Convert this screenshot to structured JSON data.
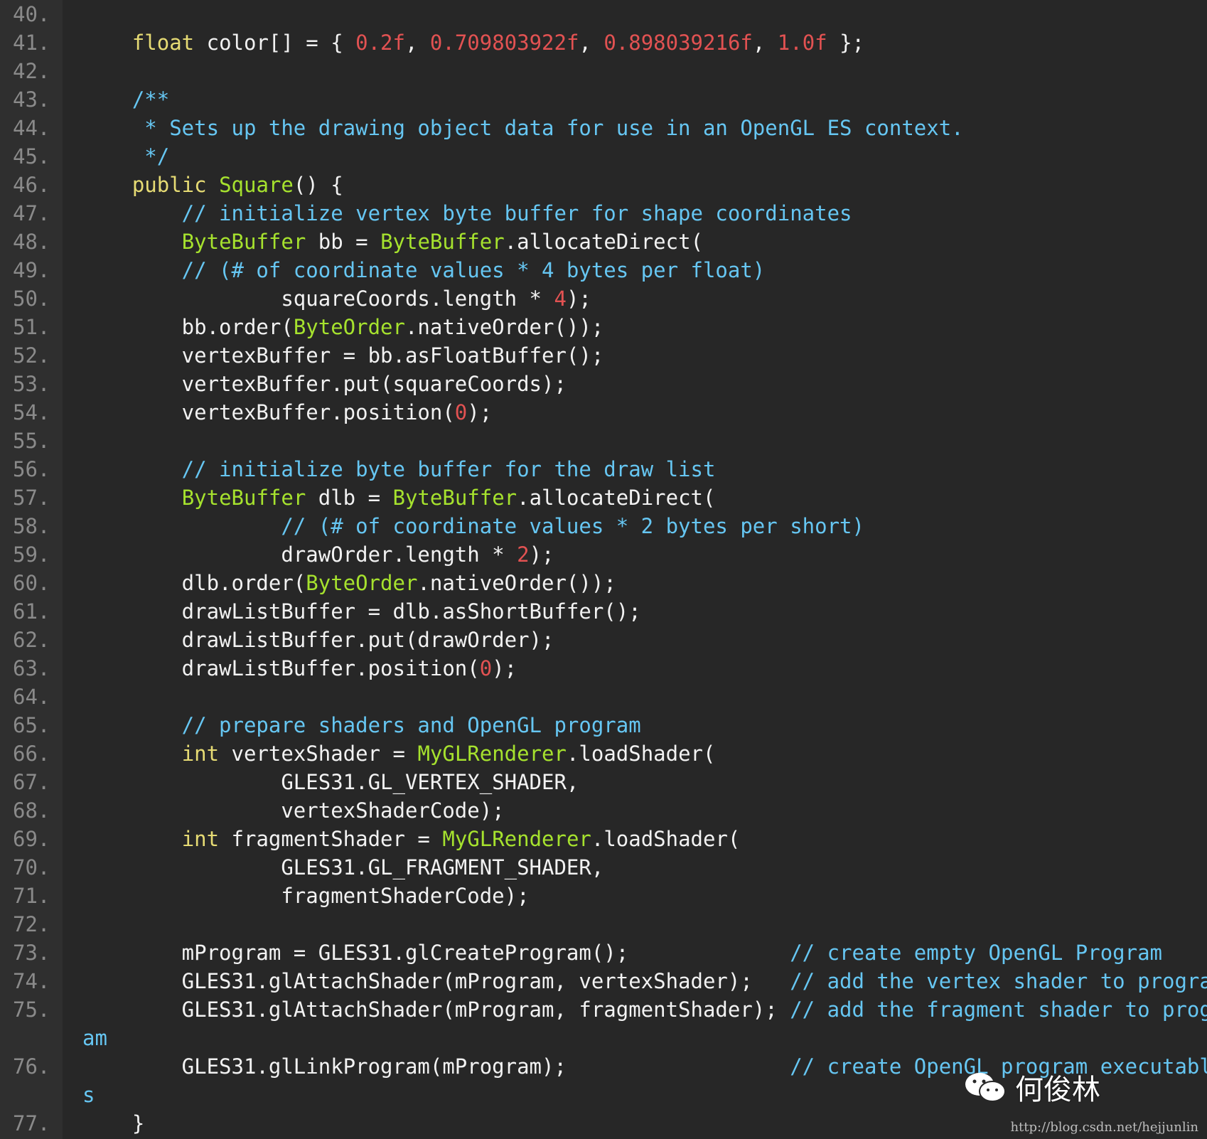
{
  "editor": {
    "colors": {
      "background": "#272727",
      "gutter": "#2f2f2f",
      "keyword": "#e6db74",
      "type": "#a6e22e",
      "number": "#e25252",
      "comment": "#66c6f2",
      "plain": "#f2f2f2"
    },
    "lines": [
      {
        "n": "40.",
        "tokens": []
      },
      {
        "n": "41.",
        "tokens": [
          {
            "t": "    ",
            "c": "pl"
          },
          {
            "t": "float",
            "c": "kw"
          },
          {
            "t": " color[] = { ",
            "c": "pl"
          },
          {
            "t": "0.2f",
            "c": "num"
          },
          {
            "t": ", ",
            "c": "pl"
          },
          {
            "t": "0.709803922f",
            "c": "num"
          },
          {
            "t": ", ",
            "c": "pl"
          },
          {
            "t": "0.898039216f",
            "c": "num"
          },
          {
            "t": ", ",
            "c": "pl"
          },
          {
            "t": "1.0f",
            "c": "num"
          },
          {
            "t": " };",
            "c": "pl"
          }
        ]
      },
      {
        "n": "42.",
        "tokens": []
      },
      {
        "n": "43.",
        "tokens": [
          {
            "t": "    /**",
            "c": "cm"
          }
        ]
      },
      {
        "n": "44.",
        "tokens": [
          {
            "t": "     * Sets up the drawing object data for use in an OpenGL ES context.",
            "c": "cm"
          }
        ]
      },
      {
        "n": "45.",
        "tokens": [
          {
            "t": "     */",
            "c": "cm"
          }
        ]
      },
      {
        "n": "46.",
        "tokens": [
          {
            "t": "    ",
            "c": "pl"
          },
          {
            "t": "public",
            "c": "kw"
          },
          {
            "t": " ",
            "c": "pl"
          },
          {
            "t": "Square",
            "c": "ty"
          },
          {
            "t": "() {",
            "c": "pl"
          }
        ]
      },
      {
        "n": "47.",
        "tokens": [
          {
            "t": "        // initialize vertex byte buffer for shape coordinates",
            "c": "cm"
          }
        ]
      },
      {
        "n": "48.",
        "tokens": [
          {
            "t": "        ",
            "c": "pl"
          },
          {
            "t": "ByteBuffer",
            "c": "ty"
          },
          {
            "t": " bb = ",
            "c": "pl"
          },
          {
            "t": "ByteBuffer",
            "c": "ty"
          },
          {
            "t": ".allocateDirect(",
            "c": "pl"
          }
        ]
      },
      {
        "n": "49.",
        "tokens": [
          {
            "t": "        // (# of coordinate values * 4 bytes per float)",
            "c": "cm"
          }
        ]
      },
      {
        "n": "50.",
        "tokens": [
          {
            "t": "                squareCoords.length * ",
            "c": "pl"
          },
          {
            "t": "4",
            "c": "num"
          },
          {
            "t": ");",
            "c": "pl"
          }
        ]
      },
      {
        "n": "51.",
        "tokens": [
          {
            "t": "        bb.order(",
            "c": "pl"
          },
          {
            "t": "ByteOrder",
            "c": "ty"
          },
          {
            "t": ".nativeOrder());",
            "c": "pl"
          }
        ]
      },
      {
        "n": "52.",
        "tokens": [
          {
            "t": "        vertexBuffer = bb.asFloatBuffer();",
            "c": "pl"
          }
        ]
      },
      {
        "n": "53.",
        "tokens": [
          {
            "t": "        vertexBuffer.put(squareCoords);",
            "c": "pl"
          }
        ]
      },
      {
        "n": "54.",
        "tokens": [
          {
            "t": "        vertexBuffer.position(",
            "c": "pl"
          },
          {
            "t": "0",
            "c": "num"
          },
          {
            "t": ");",
            "c": "pl"
          }
        ]
      },
      {
        "n": "55.",
        "tokens": []
      },
      {
        "n": "56.",
        "tokens": [
          {
            "t": "        // initialize byte buffer for the draw list",
            "c": "cm"
          }
        ]
      },
      {
        "n": "57.",
        "tokens": [
          {
            "t": "        ",
            "c": "pl"
          },
          {
            "t": "ByteBuffer",
            "c": "ty"
          },
          {
            "t": " dlb = ",
            "c": "pl"
          },
          {
            "t": "ByteBuffer",
            "c": "ty"
          },
          {
            "t": ".allocateDirect(",
            "c": "pl"
          }
        ]
      },
      {
        "n": "58.",
        "tokens": [
          {
            "t": "                // (# of coordinate values * 2 bytes per short)",
            "c": "cm"
          }
        ]
      },
      {
        "n": "59.",
        "tokens": [
          {
            "t": "                drawOrder.length * ",
            "c": "pl"
          },
          {
            "t": "2",
            "c": "num"
          },
          {
            "t": ");",
            "c": "pl"
          }
        ]
      },
      {
        "n": "60.",
        "tokens": [
          {
            "t": "        dlb.order(",
            "c": "pl"
          },
          {
            "t": "ByteOrder",
            "c": "ty"
          },
          {
            "t": ".nativeOrder());",
            "c": "pl"
          }
        ]
      },
      {
        "n": "61.",
        "tokens": [
          {
            "t": "        drawListBuffer = dlb.asShortBuffer();",
            "c": "pl"
          }
        ]
      },
      {
        "n": "62.",
        "tokens": [
          {
            "t": "        drawListBuffer.put(drawOrder);",
            "c": "pl"
          }
        ]
      },
      {
        "n": "63.",
        "tokens": [
          {
            "t": "        drawListBuffer.position(",
            "c": "pl"
          },
          {
            "t": "0",
            "c": "num"
          },
          {
            "t": ");",
            "c": "pl"
          }
        ]
      },
      {
        "n": "64.",
        "tokens": []
      },
      {
        "n": "65.",
        "tokens": [
          {
            "t": "        // prepare shaders and OpenGL program",
            "c": "cm"
          }
        ]
      },
      {
        "n": "66.",
        "tokens": [
          {
            "t": "        ",
            "c": "pl"
          },
          {
            "t": "int",
            "c": "kw"
          },
          {
            "t": " vertexShader = ",
            "c": "pl"
          },
          {
            "t": "MyGLRenderer",
            "c": "ty"
          },
          {
            "t": ".loadShader(",
            "c": "pl"
          }
        ]
      },
      {
        "n": "67.",
        "tokens": [
          {
            "t": "                GLES31.GL_VERTEX_SHADER,",
            "c": "pl"
          }
        ]
      },
      {
        "n": "68.",
        "tokens": [
          {
            "t": "                vertexShaderCode);",
            "c": "pl"
          }
        ]
      },
      {
        "n": "69.",
        "tokens": [
          {
            "t": "        ",
            "c": "pl"
          },
          {
            "t": "int",
            "c": "kw"
          },
          {
            "t": " fragmentShader = ",
            "c": "pl"
          },
          {
            "t": "MyGLRenderer",
            "c": "ty"
          },
          {
            "t": ".loadShader(",
            "c": "pl"
          }
        ]
      },
      {
        "n": "70.",
        "tokens": [
          {
            "t": "                GLES31.GL_FRAGMENT_SHADER,",
            "c": "pl"
          }
        ]
      },
      {
        "n": "71.",
        "tokens": [
          {
            "t": "                fragmentShaderCode);",
            "c": "pl"
          }
        ]
      },
      {
        "n": "72.",
        "tokens": []
      },
      {
        "n": "73.",
        "tokens": [
          {
            "t": "        mProgram = GLES31.glCreateProgram();             ",
            "c": "pl"
          },
          {
            "t": "// create empty OpenGL Program",
            "c": "cm"
          }
        ]
      },
      {
        "n": "74.",
        "tokens": [
          {
            "t": "        GLES31.glAttachShader(mProgram, vertexShader);   ",
            "c": "pl"
          },
          {
            "t": "// add the vertex shader to program",
            "c": "cm"
          }
        ]
      },
      {
        "n": "75.",
        "tokens": [
          {
            "t": "        GLES31.glAttachShader(mProgram, fragmentShader); ",
            "c": "pl"
          },
          {
            "t": "// add the fragment shader to progr",
            "c": "cm"
          }
        ]
      },
      {
        "n": "",
        "tokens": [
          {
            "t": "am",
            "c": "cm"
          }
        ]
      },
      {
        "n": "76.",
        "tokens": [
          {
            "t": "        GLES31.glLinkProgram(mProgram);                  ",
            "c": "pl"
          },
          {
            "t": "// create OpenGL program executable",
            "c": "cm"
          }
        ]
      },
      {
        "n": "",
        "tokens": [
          {
            "t": "s",
            "c": "cm"
          }
        ]
      },
      {
        "n": "77.",
        "tokens": [
          {
            "t": "    }",
            "c": "pl"
          }
        ]
      }
    ]
  },
  "watermark": {
    "icon": "wechat-icon",
    "author": "何俊林",
    "url": "http://blog.csdn.net/hejjunlin"
  }
}
